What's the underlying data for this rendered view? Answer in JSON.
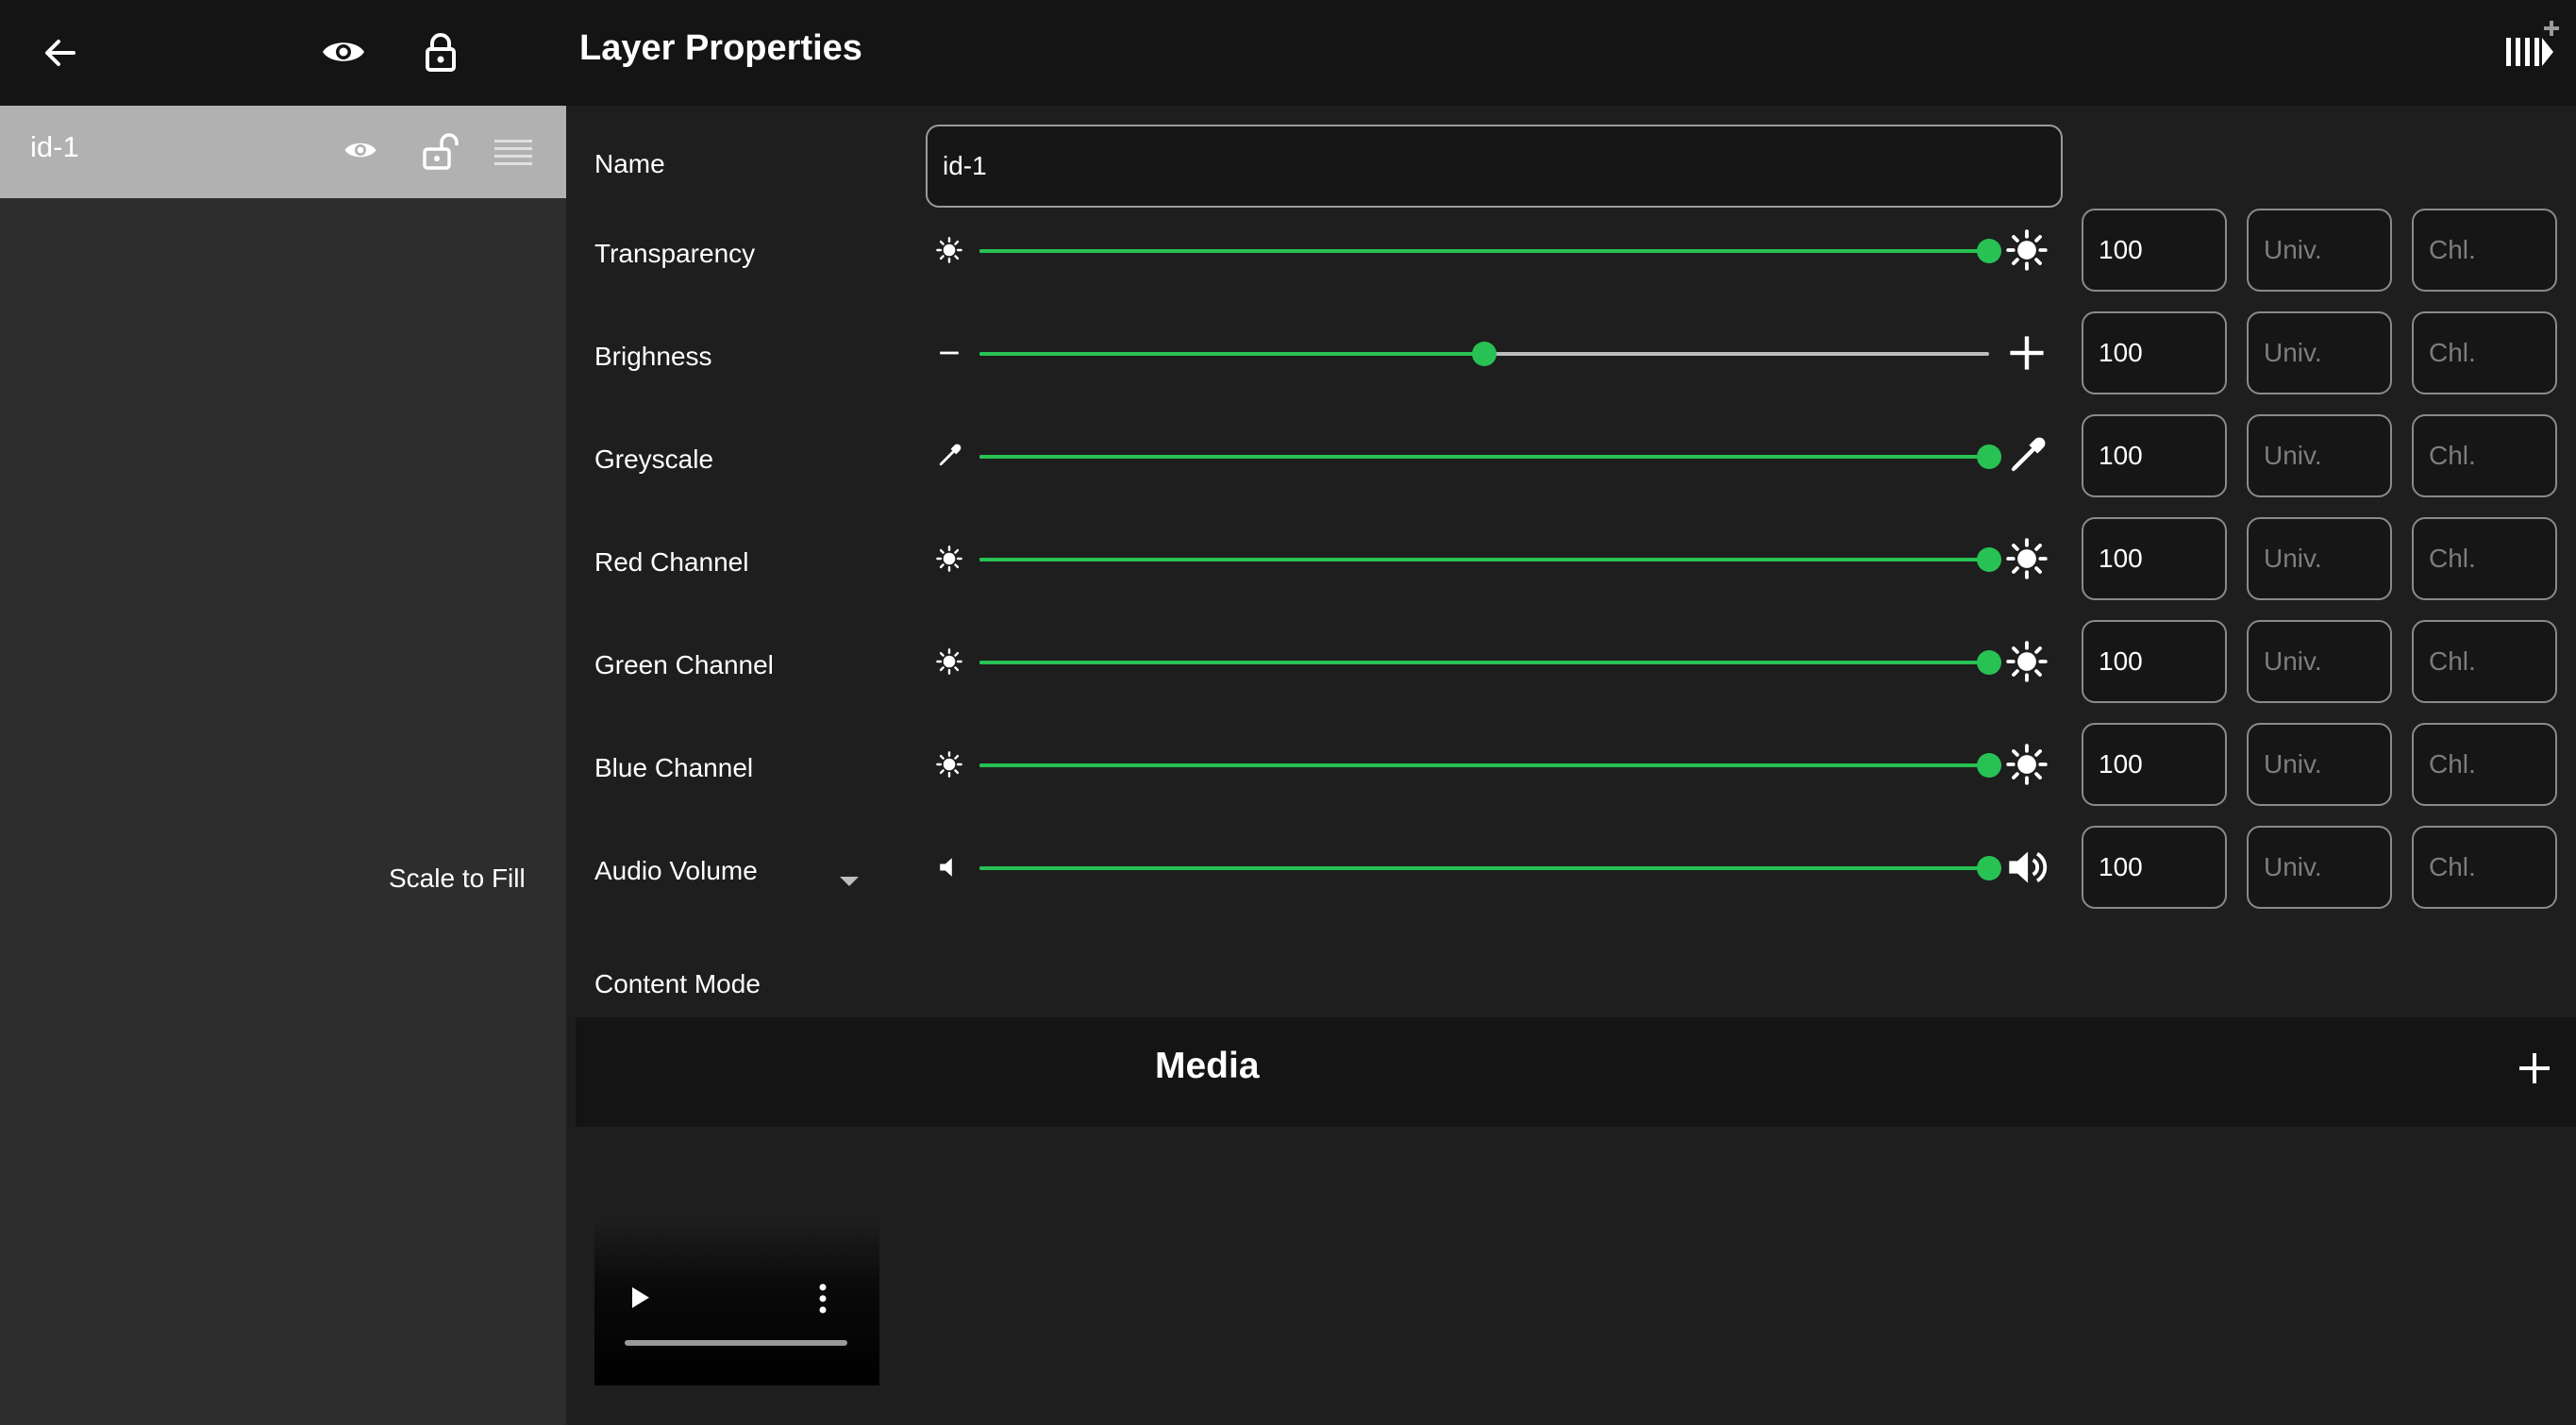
{
  "app": {
    "title": "Layer Properties",
    "accent_color": "#27c253"
  },
  "left_toolbar": {
    "icons": [
      "back-arrow-icon",
      "eye-icon",
      "lock-icon"
    ]
  },
  "layers": [
    {
      "name": "id-1",
      "icons": [
        "eye-icon",
        "unlock-icon",
        "drag-handle-icon"
      ]
    }
  ],
  "properties": {
    "name_label": "Name",
    "name_value": "id-1",
    "content_mode_label": "Content Mode",
    "content_mode_value": "Scale to Fill",
    "rows": [
      {
        "label": "Transparency",
        "value_percent": 100,
        "value_text": "100",
        "univ_placeholder": "Univ.",
        "chl_placeholder": "Chl.",
        "icon_min": "sun-small-icon",
        "icon_max": "sun-large-icon"
      },
      {
        "label": "Brighness",
        "value_percent": 50,
        "value_text": "100",
        "univ_placeholder": "Univ.",
        "chl_placeholder": "Chl.",
        "icon_min": "minus-icon",
        "icon_max": "plus-icon"
      },
      {
        "label": "Greyscale",
        "value_percent": 100,
        "value_text": "100",
        "univ_placeholder": "Univ.",
        "chl_placeholder": "Chl.",
        "icon_min": "eyedropper-small-icon",
        "icon_max": "eyedropper-large-icon"
      },
      {
        "label": "Red Channel",
        "value_percent": 100,
        "value_text": "100",
        "univ_placeholder": "Univ.",
        "chl_placeholder": "Chl.",
        "icon_min": "sun-small-icon",
        "icon_max": "sun-large-icon"
      },
      {
        "label": "Green Channel",
        "value_percent": 100,
        "value_text": "100",
        "univ_placeholder": "Univ.",
        "chl_placeholder": "Chl.",
        "icon_min": "sun-small-icon",
        "icon_max": "sun-large-icon"
      },
      {
        "label": "Blue Channel",
        "value_percent": 100,
        "value_text": "100",
        "univ_placeholder": "Univ.",
        "chl_placeholder": "Chl.",
        "icon_min": "sun-small-icon",
        "icon_max": "sun-large-icon"
      },
      {
        "label": "Audio Volume",
        "value_percent": 100,
        "value_text": "100",
        "univ_placeholder": "Univ.",
        "chl_placeholder": "Chl.",
        "icon_min": "speaker-small-icon",
        "icon_max": "speaker-large-icon"
      }
    ]
  },
  "media": {
    "title": "Media",
    "items": [
      {
        "icons": [
          "play-icon",
          "more-vert-icon"
        ],
        "progress_percent": 0
      }
    ]
  }
}
